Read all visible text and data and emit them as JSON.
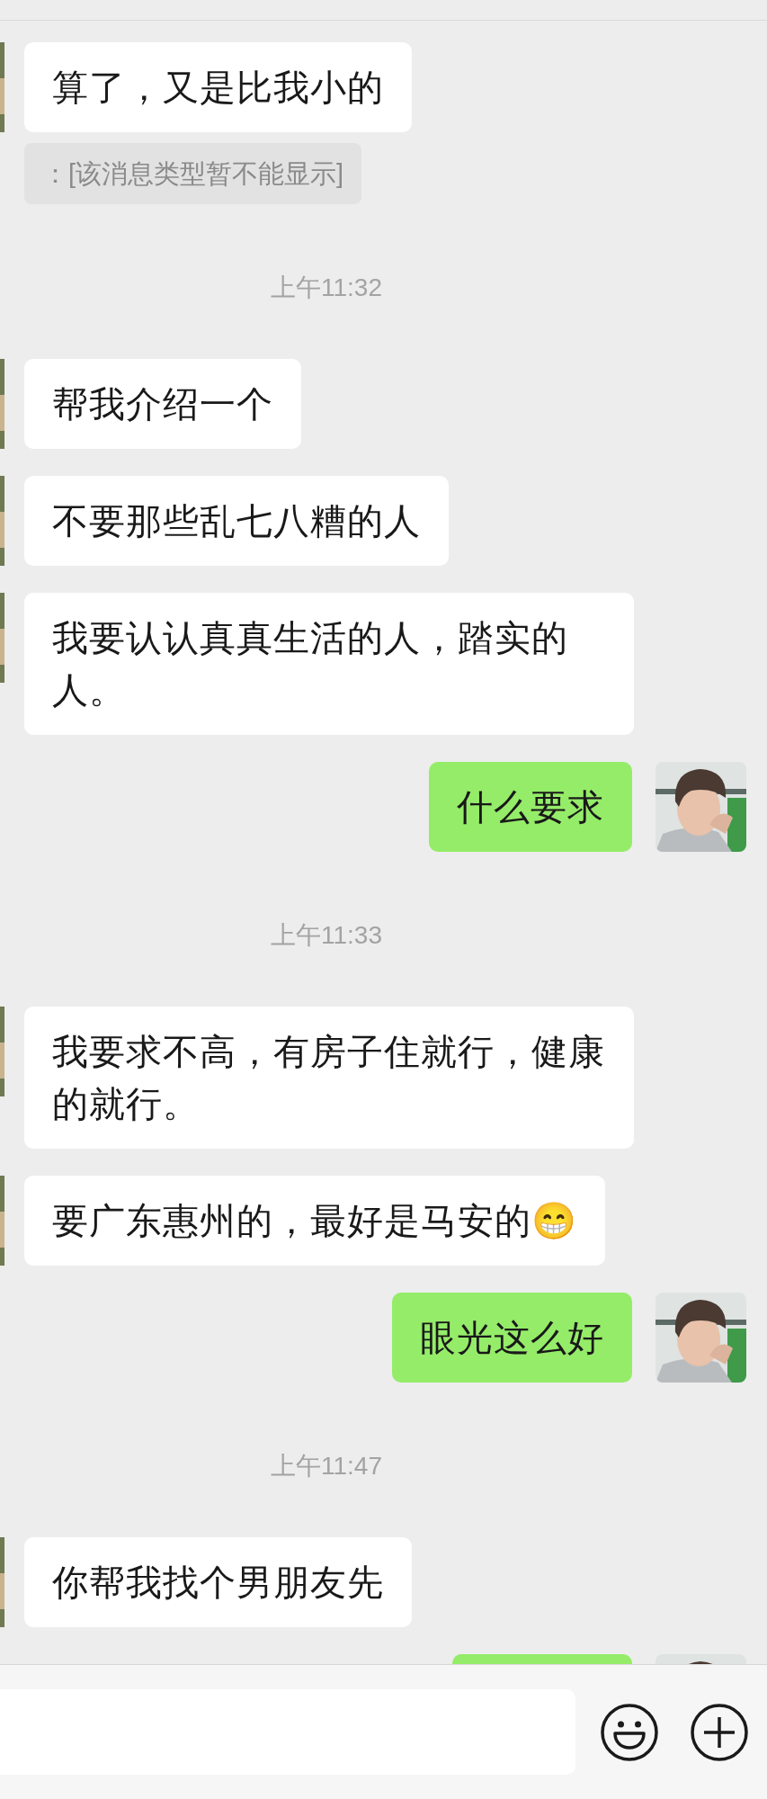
{
  "messages": [
    {
      "kind": "received",
      "text": "算了，又是比我小的"
    },
    {
      "kind": "system",
      "text": "：[该消息类型暂不能显示]"
    },
    {
      "kind": "time",
      "text": "上午11:32"
    },
    {
      "kind": "received",
      "text": "帮我介绍一个"
    },
    {
      "kind": "received",
      "text": "不要那些乱七八糟的人"
    },
    {
      "kind": "received",
      "text": "我要认认真真生活的人，踏实的人。"
    },
    {
      "kind": "sent",
      "text": "什么要求"
    },
    {
      "kind": "time",
      "text": "上午11:33"
    },
    {
      "kind": "received",
      "text": "我要求不高，有房子住就行，健康的就行。"
    },
    {
      "kind": "received",
      "text": "要广东惠州的，最好是马安的😁"
    },
    {
      "kind": "sent",
      "text": "眼光这么好"
    },
    {
      "kind": "time",
      "text": "上午11:47"
    },
    {
      "kind": "received",
      "text": "你帮我找个男朋友先"
    },
    {
      "kind": "sent_cut"
    }
  ]
}
